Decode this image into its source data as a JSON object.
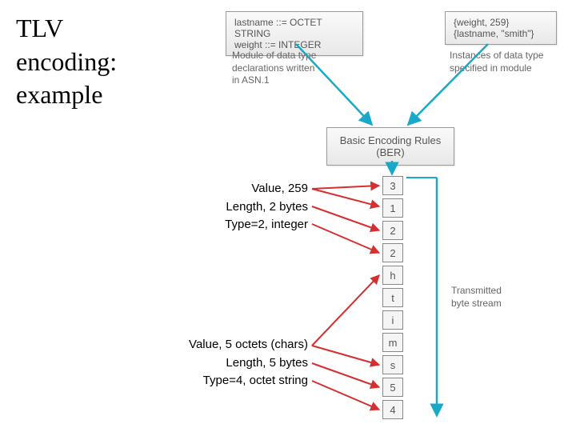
{
  "title_lines": [
    "TLV",
    "encoding:",
    "example"
  ],
  "module_box": {
    "line1": "lastname ::= OCTET STRING",
    "line2": "weight ::= INTEGER"
  },
  "module_caption": [
    "Module of data type",
    "declarations written",
    "in ASN.1"
  ],
  "instance_box": {
    "line1": "{weight, 259}",
    "line2": "{lastname, \"smith\"}"
  },
  "instance_caption": [
    "Instances of data type",
    "specified in module"
  ],
  "ber_box": {
    "line1": "Basic Encoding Rules",
    "line2": "(BER)"
  },
  "byte_stream": [
    "3",
    "1",
    "2",
    "2",
    "h",
    "t",
    "i",
    "m",
    "s",
    "5",
    "4"
  ],
  "stream_label": [
    "Transmitted",
    "byte stream"
  ],
  "annot_top": {
    "l1": "Value, 259",
    "l2": "Length, 2 bytes",
    "l3": "Type=2, integer"
  },
  "annot_bottom": {
    "l1": "Value, 5 octets (chars)",
    "l2": "Length, 5 bytes",
    "l3": "Type=4, octet string"
  },
  "colors": {
    "cyan": "#18a8c8",
    "red": "#d62f2f",
    "grey": "#888"
  }
}
